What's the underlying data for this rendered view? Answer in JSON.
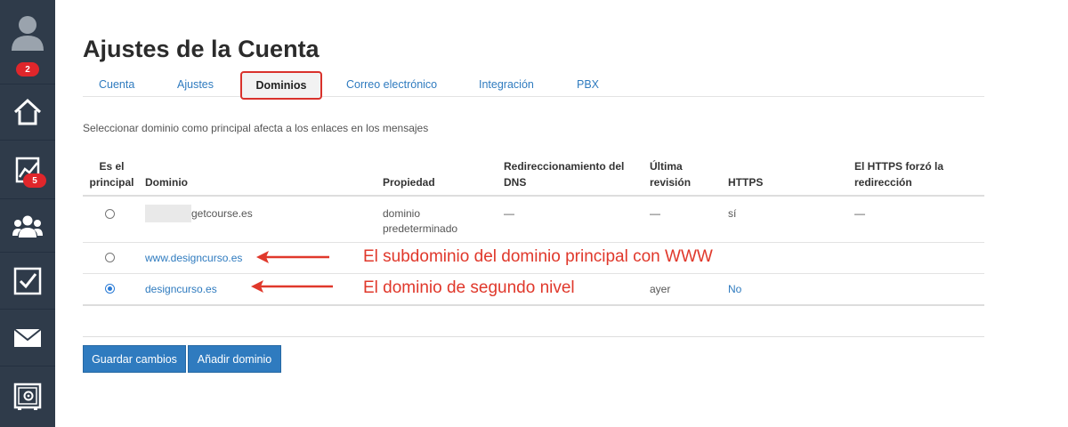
{
  "sidebar": {
    "badges": {
      "notifications": "2",
      "stats": "5"
    },
    "icons": [
      "avatar-icon",
      "home-icon",
      "chart-icon",
      "users-icon",
      "tasks-icon",
      "mail-icon",
      "safe-icon"
    ]
  },
  "page": {
    "title": "Ajustes de la Cuenta"
  },
  "tabs": [
    {
      "label": "Cuenta"
    },
    {
      "label": "Ajustes"
    },
    {
      "label": "Dominios"
    },
    {
      "label": "Correo electrónico"
    },
    {
      "label": "Integración"
    },
    {
      "label": "PBX"
    }
  ],
  "description": "Seleccionar dominio como principal afecta a los enlaces en los mensajes",
  "table": {
    "headers": {
      "principal": "Es el principal",
      "domain": "Dominio",
      "property": "Propiedad",
      "dns": "Redireccionamiento del DNS",
      "revision": "Última revisión",
      "https": "HTTPS",
      "forced": "El HTTPS forzó la redirección"
    },
    "rows": [
      {
        "domain": "getcourse.es",
        "property": "dominio predeterminado",
        "dns": "—",
        "revision": "—",
        "https": "sí",
        "forced": "—",
        "selected": false
      },
      {
        "domain": "www.designcurso.es",
        "property": "",
        "dns": "",
        "revision": "",
        "https": "",
        "forced": "",
        "selected": false
      },
      {
        "domain": "designcurso.es",
        "property": "",
        "dns": "",
        "revision": "ayer",
        "https": "No",
        "forced": "",
        "selected": true
      }
    ]
  },
  "annotations": {
    "subdomain": "El subdominio del dominio principal con WWW",
    "second_level": "El dominio de segundo nivel"
  },
  "buttons": {
    "save": "Guardar cambios",
    "add": "Añadir dominio"
  },
  "colors": {
    "sidebar": "#2f3b4a",
    "accent": "#2f7bbf",
    "badge": "#e0262b",
    "annotation": "#e0382b"
  }
}
